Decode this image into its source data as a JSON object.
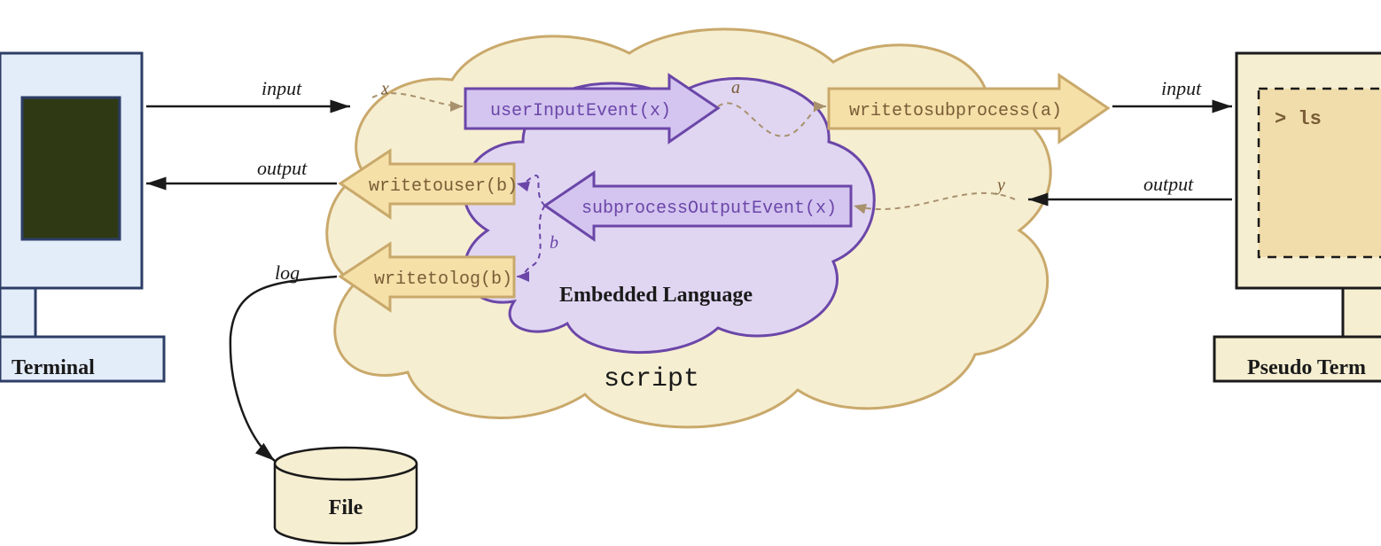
{
  "terminal": {
    "label": "Terminal"
  },
  "pseudo_terminal": {
    "label": "Pseudo Term",
    "prompt": "> ls"
  },
  "file": {
    "label": "File"
  },
  "script_cloud": {
    "label": "script"
  },
  "embedded_cloud": {
    "label": "Embedded Language"
  },
  "arrows": {
    "input_left": "input",
    "output_left": "output",
    "log": "log",
    "input_right": "input",
    "output_right": "output"
  },
  "variables": {
    "x": "x",
    "a": "a",
    "y": "y",
    "b": "b"
  },
  "blocks": {
    "userInputEvent": "userInputEvent(x)",
    "writetosubprocess": "writetosubprocess(a)",
    "writetouser": "writetouser(b)",
    "subprocessOutputEvent": "subprocessOutputEvent(x)",
    "writetolog": "writetolog(b)"
  },
  "colors": {
    "cream_fill": "#f6eed1",
    "cream_stroke": "#c9a96b",
    "cream_arrow_fill": "#f5e0a8",
    "blue_fill": "#e3ecf9",
    "blue_stroke": "#2d3e66",
    "purple_fill": "#e0d6f2",
    "purple_stroke": "#6b46a8",
    "purple_arrow_fill": "#d4c5f0",
    "screen_green": "#2f3a15",
    "text_dark": "#1a1a1a",
    "text_brown": "#7a5c36",
    "dash_brown": "#a8916d",
    "dash_purple": "#6b46a8"
  }
}
